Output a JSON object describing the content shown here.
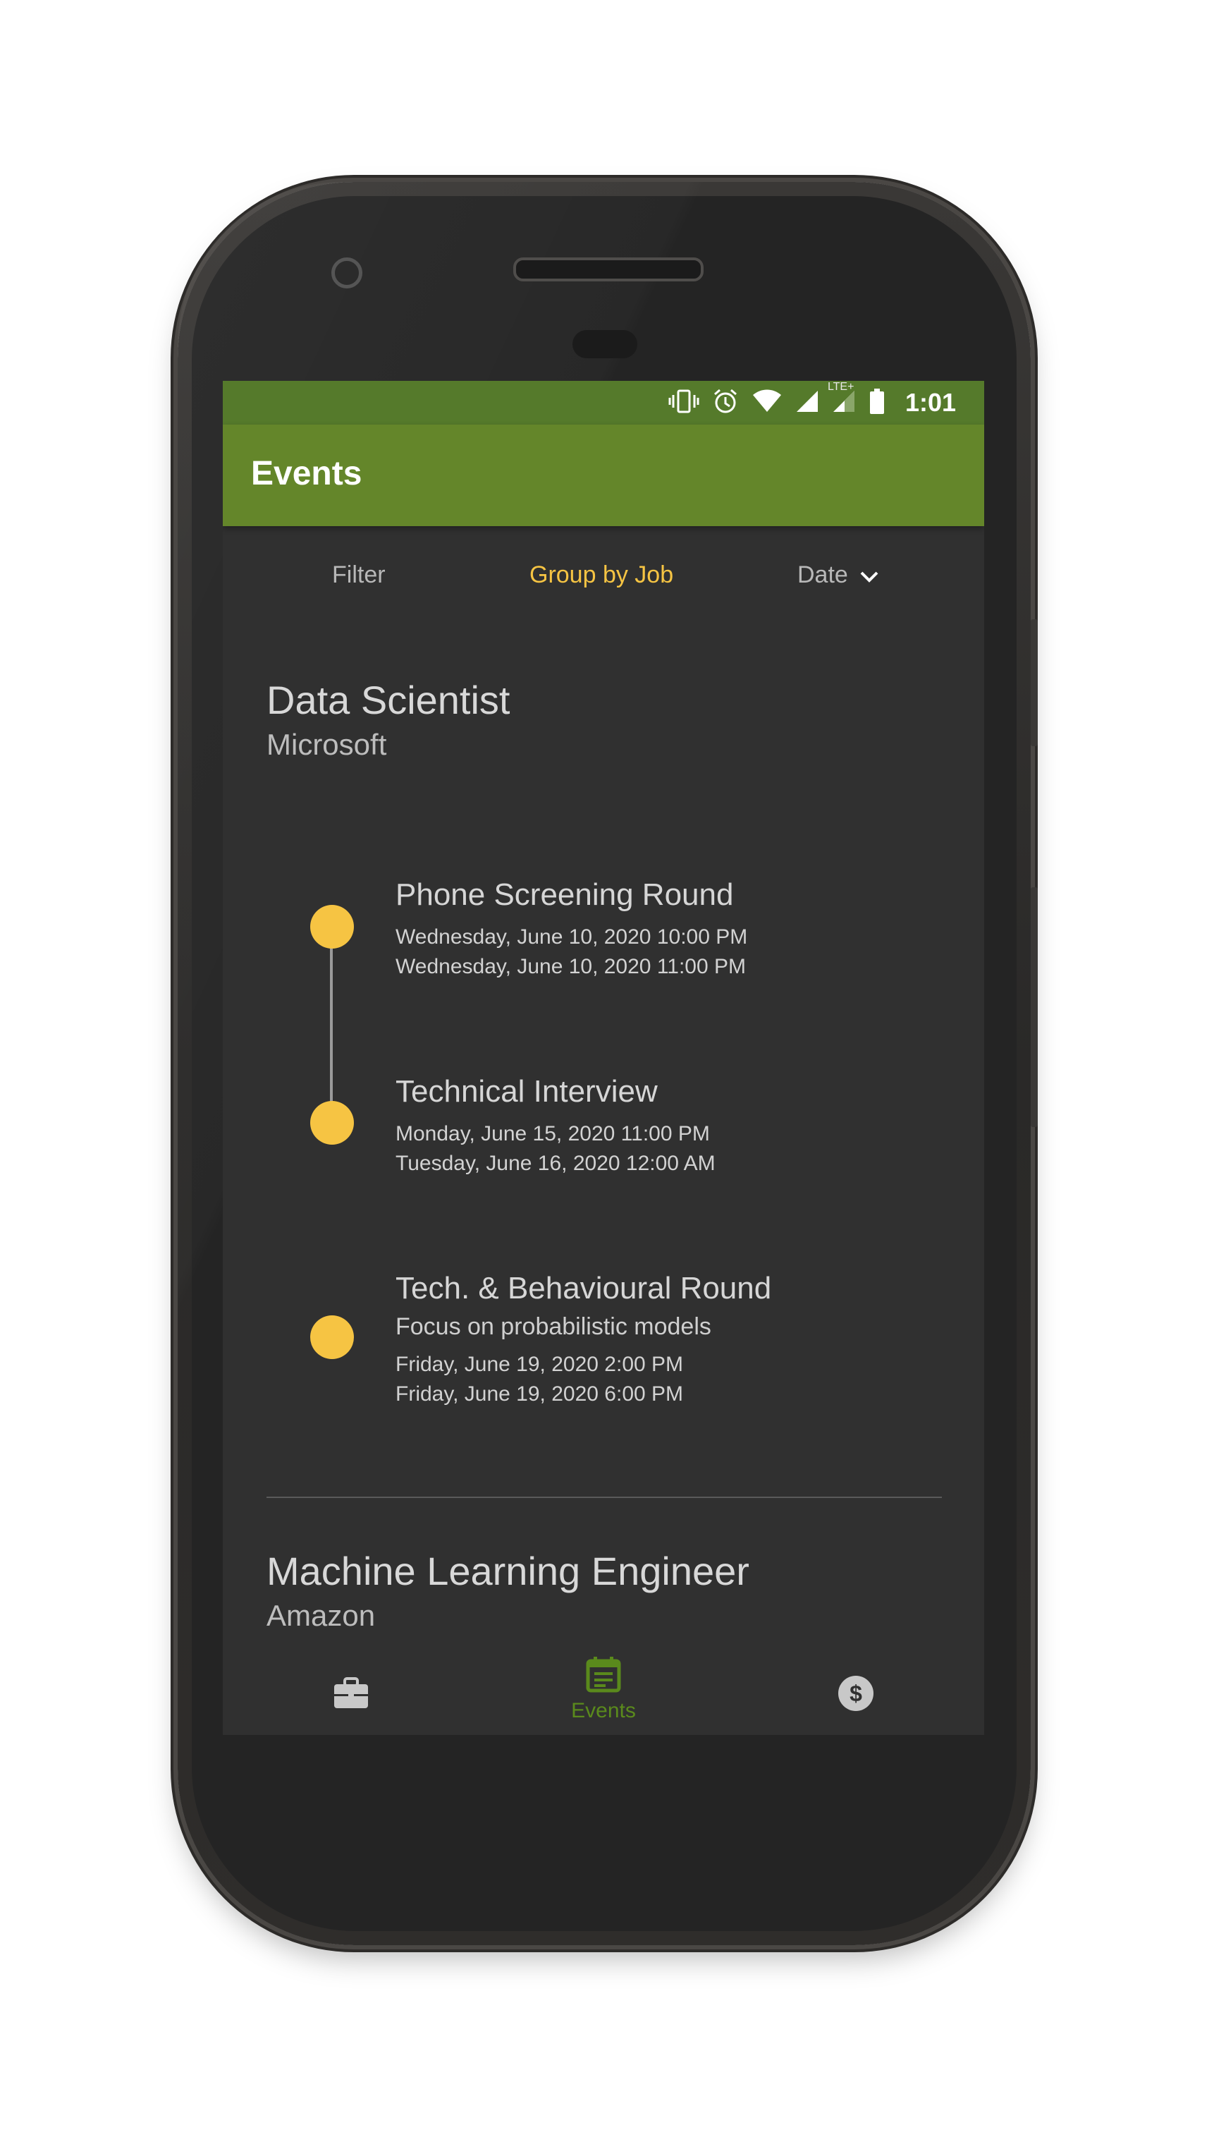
{
  "status_bar": {
    "time": "1:01",
    "network_label": "LTE+",
    "icons": [
      "vibrate-icon",
      "alarm-icon",
      "wifi-icon",
      "signal-icon",
      "lte-signal-icon",
      "battery-icon"
    ]
  },
  "app_bar": {
    "title": "Events"
  },
  "toolbar": {
    "filter_label": "Filter",
    "group_label": "Group by Job",
    "date_label": "Date"
  },
  "groups": [
    {
      "title": "Data Scientist",
      "company": "Microsoft",
      "events": [
        {
          "title": "Phone Screening Round",
          "note": "",
          "start": "Wednesday, June 10, 2020 10:00 PM",
          "end": "Wednesday, June 10, 2020 11:00 PM"
        },
        {
          "title": "Technical Interview",
          "note": "",
          "start": "Monday, June 15, 2020 11:00 PM",
          "end": "Tuesday, June 16, 2020 12:00 AM"
        },
        {
          "title": "Tech. & Behavioural Round",
          "note": "Focus on probabilistic models",
          "start": "Friday, June 19, 2020 2:00 PM",
          "end": "Friday, June 19, 2020 6:00 PM"
        }
      ]
    },
    {
      "title": "Machine Learning Engineer",
      "company": "Amazon",
      "events": []
    }
  ],
  "bottom_nav": {
    "items": [
      {
        "icon": "briefcase-icon",
        "label": ""
      },
      {
        "icon": "calendar-icon",
        "label": "Events"
      },
      {
        "icon": "dollar-icon",
        "label": ""
      }
    ]
  },
  "colors": {
    "status_bar": "#557a2b",
    "app_bar": "#64862a",
    "accent": "#f6c443",
    "active_nav": "#5a8a1c",
    "background": "#303030"
  }
}
